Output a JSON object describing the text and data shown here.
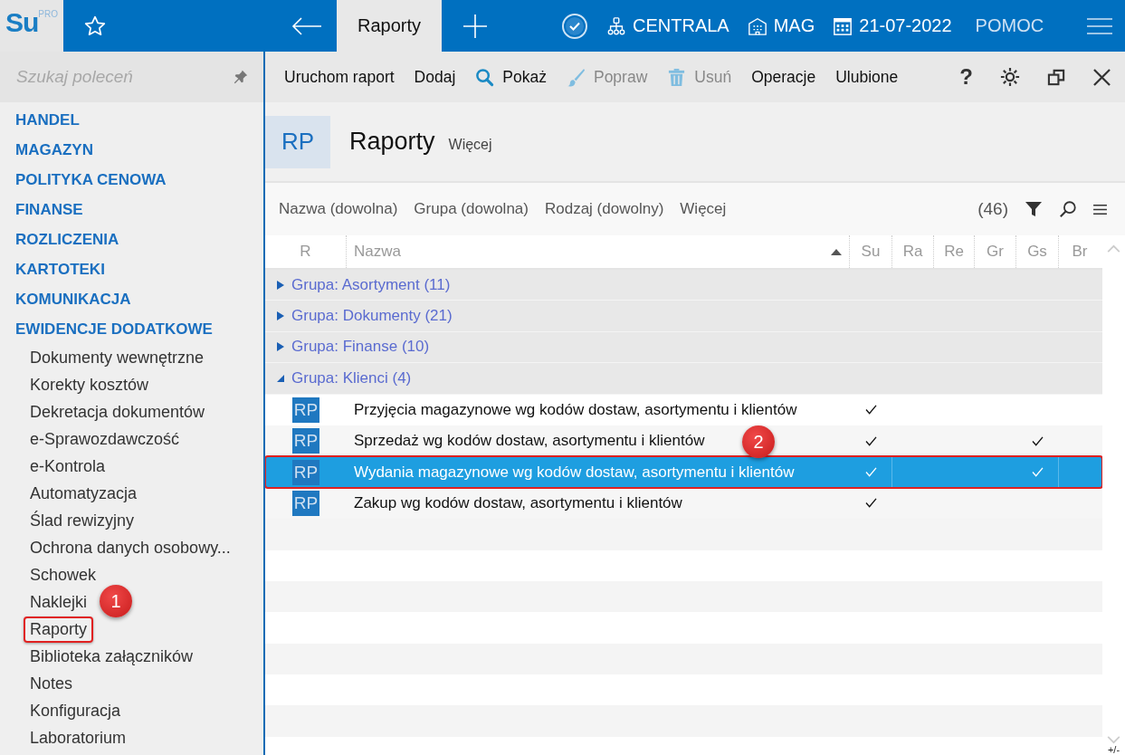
{
  "logo": {
    "text": "Su",
    "sup": "PRO"
  },
  "top_bar": {
    "tabs": [
      {
        "label": "Raporty",
        "selected": true
      }
    ],
    "context": [
      {
        "kind": "network",
        "label": "CENTRALA"
      },
      {
        "kind": "building",
        "label": "MAG"
      },
      {
        "kind": "calendar",
        "label": "21-07-2022"
      },
      {
        "kind": "plain",
        "label": "POMOC"
      }
    ]
  },
  "sidebar": {
    "search": {
      "placeholder": "Szukaj poleceń"
    },
    "modules": [
      {
        "label": "HANDEL"
      },
      {
        "label": "MAGAZYN"
      },
      {
        "label": "POLITYKA CENOWA"
      },
      {
        "label": "FINANSE"
      },
      {
        "label": "ROZLICZENIA"
      },
      {
        "label": "KARTOTEKI"
      },
      {
        "label": "KOMUNIKACJA"
      },
      {
        "label": "EWIDENCJE DODATKOWE",
        "children": [
          {
            "label": "Dokumenty wewnętrzne",
            "marked": false
          },
          {
            "label": "Korekty kosztów",
            "marked": false
          },
          {
            "label": "Dekretacja dokumentów",
            "marked": false
          },
          {
            "label": "e-Sprawozdawczość",
            "marked": false
          },
          {
            "label": "e-Kontrola",
            "marked": false
          },
          {
            "label": "Automatyzacja",
            "marked": false
          },
          {
            "label": "Ślad rewizyjny",
            "marked": false
          },
          {
            "label": "Ochrona danych osobowy...",
            "marked": false
          },
          {
            "label": "Schowek",
            "marked": false
          },
          {
            "label": "Naklejki",
            "marked": false
          },
          {
            "label": "Raporty",
            "marked": true
          },
          {
            "label": "Biblioteka załączników",
            "marked": false
          },
          {
            "label": "Notes",
            "marked": false
          },
          {
            "label": "Konfiguracja",
            "marked": false
          },
          {
            "label": "Laboratorium",
            "marked": false
          }
        ]
      }
    ]
  },
  "toolbar": {
    "actions": [
      {
        "kind": "plain",
        "label": "Uruchom raport",
        "disabled": false
      },
      {
        "kind": "plain",
        "label": "Dodaj",
        "disabled": false
      },
      {
        "kind": "search",
        "label": "Pokaż",
        "disabled": false
      },
      {
        "kind": "brush",
        "label": "Popraw",
        "disabled": true
      },
      {
        "kind": "trash",
        "label": "Usuń",
        "disabled": true
      },
      {
        "kind": "plain",
        "label": "Operacje",
        "disabled": false
      },
      {
        "kind": "plain",
        "label": "Ulubione",
        "disabled": false
      }
    ],
    "help": "?"
  },
  "header": {
    "badge": "RP",
    "title": "Raporty",
    "more": "Więcej"
  },
  "filters": {
    "items": [
      "Nazwa (dowolna)",
      "Grupa (dowolna)",
      "Rodzaj (dowolny)",
      "Więcej"
    ],
    "count": "(46)"
  },
  "table": {
    "columns": [
      "R",
      "Nazwa",
      "Su",
      "Ra",
      "Re",
      "Gr",
      "Gs",
      "Br"
    ],
    "groups": [
      {
        "label": "Grupa: Asortyment (11)",
        "expanded": false
      },
      {
        "label": "Grupa: Dokumenty (21)",
        "expanded": false
      },
      {
        "label": "Grupa: Finanse (10)",
        "expanded": false
      },
      {
        "label": "Grupa: Klienci (4)",
        "expanded": true,
        "rows": [
          {
            "badge": "RP",
            "name": "Przyjęcia magazynowe wg kodów dostaw, asortymentu i klientów",
            "selected": false,
            "marked": false,
            "checks": [
              true,
              false,
              false,
              false,
              false,
              false
            ]
          },
          {
            "badge": "RP",
            "name": "Sprzedaż wg kodów dostaw, asortymentu i klientów",
            "selected": false,
            "marked": false,
            "checks": [
              true,
              false,
              false,
              false,
              true,
              false
            ]
          },
          {
            "badge": "RP",
            "name": "Wydania magazynowe wg kodów dostaw, asortymentu i klientów",
            "selected": true,
            "marked": true,
            "checks": [
              true,
              false,
              false,
              false,
              true,
              false
            ]
          },
          {
            "badge": "RP",
            "name": "Zakup wg kodów dostaw, asortymentu i klientów",
            "selected": false,
            "marked": false,
            "checks": [
              true,
              false,
              false,
              false,
              false,
              false
            ]
          }
        ]
      }
    ],
    "corner": "+/-"
  },
  "callouts": [
    "1",
    "2"
  ]
}
